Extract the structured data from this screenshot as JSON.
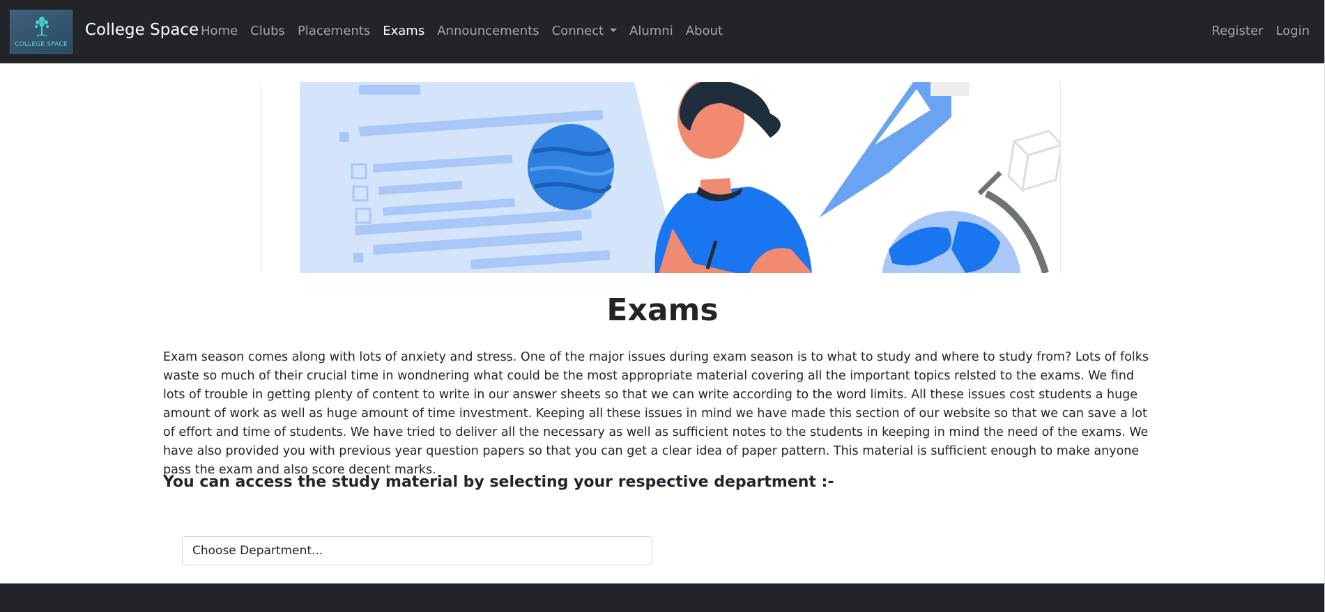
{
  "navbar": {
    "logo_text": "COLLEGE SPACE",
    "brand": "College Space",
    "links": [
      {
        "label": "Home"
      },
      {
        "label": "Clubs"
      },
      {
        "label": "Placements"
      },
      {
        "label": "Exams",
        "active": true
      },
      {
        "label": "Announcements"
      },
      {
        "label": "Connect",
        "dropdown": true
      },
      {
        "label": "Alumni"
      },
      {
        "label": "About"
      }
    ],
    "right_links": [
      {
        "label": "Register"
      },
      {
        "label": "Login"
      }
    ]
  },
  "main": {
    "title": "Exams",
    "intro": "Exam season comes along with lots of anxiety and stress. One of the major issues during exam season is to what to study and where to study from? Lots of folks waste so much of their crucial time in wondnering what could be the most appropriate material covering all the important topics relsted to the exams. We find lots of trouble in getting plenty of content to write in our answer sheets so that we can write according to the word limits. All these issues cost students a huge amount of work as well as huge amount of time investment. Keeping all these issues in mind we have made this section of our website so that we can save a lot of effort and time of students. We have tried to deliver all the necessary as well as sufficient notes to the students in keeping in mind the need of the exams. We have also provided you with previous year question papers so that you can get a clear idea of paper pattern. This material is sufficient enough to make anyone pass the exam and also score decent marks.",
    "subheading": "You can access the study material by selecting your respective department :-",
    "department_select": {
      "selected": "Choose Department..."
    }
  },
  "colors": {
    "navbar_bg": "#212529",
    "accent_blue": "#1a75f0",
    "light_blue": "#d4e4fb"
  }
}
